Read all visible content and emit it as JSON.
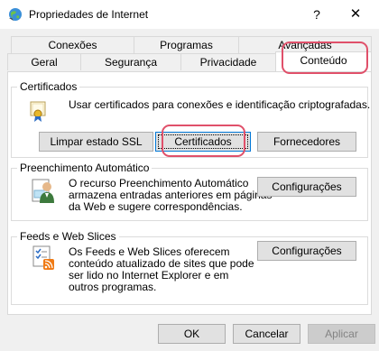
{
  "window": {
    "title": "Propriedades de Internet",
    "help_label": "?",
    "close_label": "✕"
  },
  "tabs": {
    "row1": [
      "Conexões",
      "Programas",
      "Avançadas"
    ],
    "row2": [
      "Geral",
      "Segurança",
      "Privacidade",
      "Conteúdo"
    ],
    "active": "Conteúdo"
  },
  "certificates": {
    "group_title": "Certificados",
    "description": "Usar certificados para conexões e identificação criptografadas.",
    "clear_ssl_button": "Limpar estado SSL",
    "certificates_button": "Certificados",
    "publishers_button": "Fornecedores"
  },
  "autocomplete": {
    "group_title": "Preenchimento Automático",
    "description_lines": [
      "O recurso Preenchimento Automático",
      "armazena entradas anteriores em páginas",
      "da Web e sugere correspondências."
    ],
    "settings_button": "Configurações"
  },
  "feeds": {
    "group_title": "Feeds e Web Slices",
    "description_lines": [
      "Os Feeds e Web Slices oferecem",
      "conteúdo atualizado de sites que pode",
      "ser lido no Internet Explorer e em",
      "outros programas."
    ],
    "settings_button": "Configurações"
  },
  "footer": {
    "ok_button": "OK",
    "cancel_button": "Cancelar",
    "apply_button": "Aplicar"
  },
  "colors": {
    "highlight": "#e0506a",
    "focus_border": "#0078d7"
  }
}
